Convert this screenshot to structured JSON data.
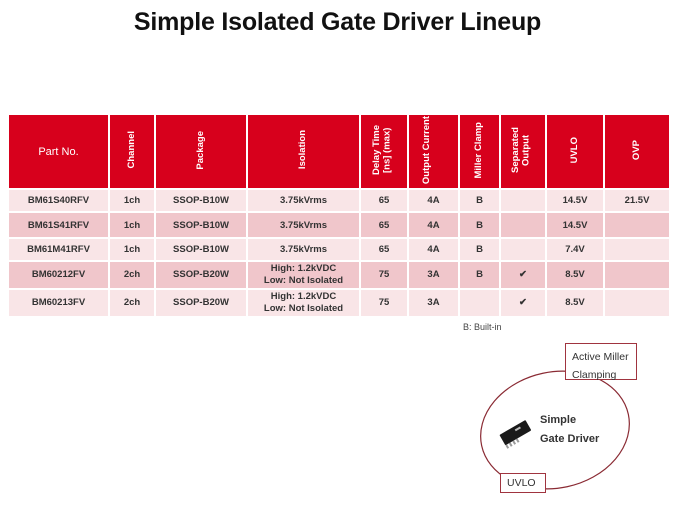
{
  "title": "Simple Isolated Gate Driver Lineup",
  "table": {
    "headers": [
      "Part No.",
      "Channel",
      "Package",
      "Isolation",
      "Delay Time [ns] (max)",
      "Output Current",
      "Miller Clamp",
      "Separated Output",
      "UVLO",
      "OVP"
    ],
    "rows": [
      {
        "part": "BM61S40RFV",
        "channel": "1ch",
        "package": "SSOP-B10W",
        "isolation_1": "3.75kVrms",
        "isolation_2": "",
        "delay": "65",
        "current": "4A",
        "miller": "B",
        "separated": "",
        "uvlo": "14.5V",
        "ovp": "21.5V"
      },
      {
        "part": "BM61S41RFV",
        "channel": "1ch",
        "package": "SSOP-B10W",
        "isolation_1": "3.75kVrms",
        "isolation_2": "",
        "delay": "65",
        "current": "4A",
        "miller": "B",
        "separated": "",
        "uvlo": "14.5V",
        "ovp": ""
      },
      {
        "part": "BM61M41RFV",
        "channel": "1ch",
        "package": "SSOP-B10W",
        "isolation_1": "3.75kVrms",
        "isolation_2": "",
        "delay": "65",
        "current": "4A",
        "miller": "B",
        "separated": "",
        "uvlo": "7.4V",
        "ovp": ""
      },
      {
        "part": "BM60212FV",
        "channel": "2ch",
        "package": "SSOP-B20W",
        "isolation_1": "High: 1.2kVDC",
        "isolation_2": "Low: Not Isolated",
        "delay": "75",
        "current": "3A",
        "miller": "B",
        "separated": "✔",
        "uvlo": "8.5V",
        "ovp": ""
      },
      {
        "part": "BM60213FV",
        "channel": "2ch",
        "package": "SSOP-B20W",
        "isolation_1": "High: 1.2kVDC",
        "isolation_2": "Low: Not Isolated",
        "delay": "75",
        "current": "3A",
        "miller": "",
        "separated": "✔",
        "uvlo": "8.5V",
        "ovp": ""
      }
    ],
    "footnote": "B: Built-in"
  },
  "diagram": {
    "top_box": "Active Miller Clamping",
    "top_box_line1": "Active Miller",
    "top_box_line2": "Clamping",
    "center_line1": "Simple",
    "center_line2": "Gate Driver",
    "bottom_box": "UVLO",
    "chip_icon": "ic-chip-icon"
  },
  "colors": {
    "header_red": "#d7001c",
    "row_light": "#f9e5e7",
    "row_dark": "#f0c6cb",
    "box_border": "#a0343f"
  }
}
